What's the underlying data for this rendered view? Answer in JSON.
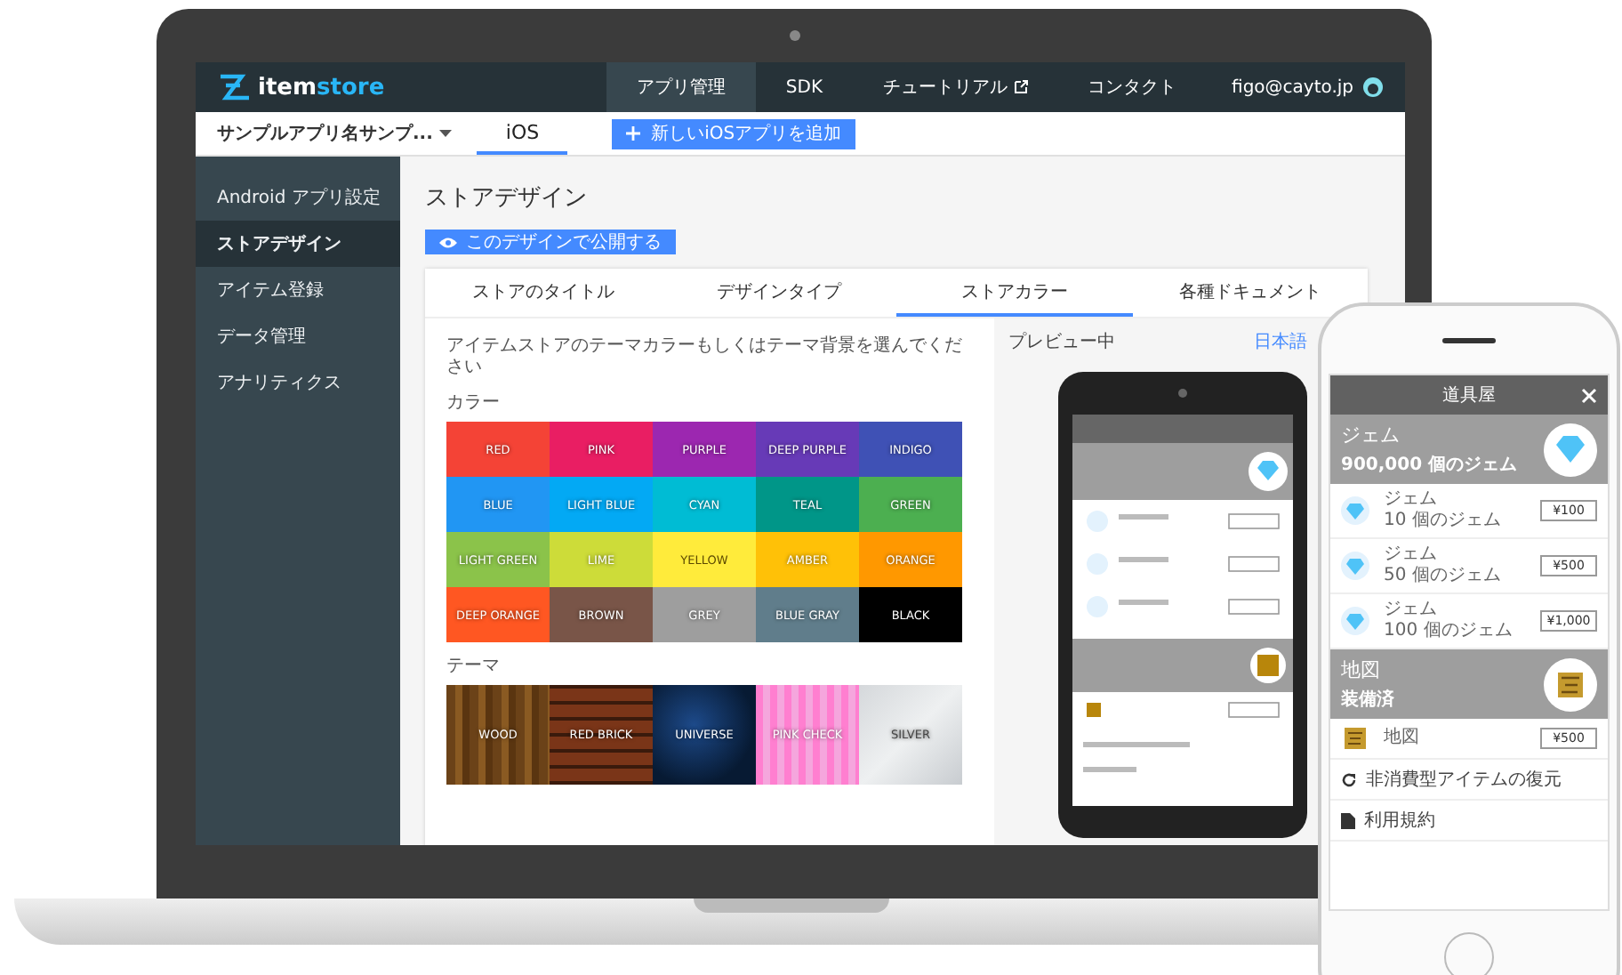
{
  "header": {
    "logo": {
      "part1": "item",
      "part2": "store"
    },
    "nav": [
      {
        "label": "アプリ管理",
        "selected": true,
        "external": false
      },
      {
        "label": "SDK",
        "selected": false,
        "external": false
      },
      {
        "label": "チュートリアル",
        "selected": false,
        "external": true
      },
      {
        "label": "コンタクト",
        "selected": false,
        "external": false
      }
    ],
    "account": "figo@cayto.jp"
  },
  "app_bar": {
    "app_select": "サンプルアプリ名サンプ...",
    "platform_tabs": [
      {
        "label": "iOS",
        "selected": true
      }
    ],
    "add_button": "新しいiOSアプリを追加"
  },
  "sidebar": {
    "items": [
      {
        "label": "Android アプリ設定",
        "selected": false
      },
      {
        "label": "ストアデザイン",
        "selected": true
      },
      {
        "label": "アイテム登録",
        "selected": false
      },
      {
        "label": "データ管理",
        "selected": false
      },
      {
        "label": "アナリティクス",
        "selected": false
      }
    ]
  },
  "page": {
    "title": "ストアデザイン",
    "publish_button": "このデザインで公開する",
    "tabs": [
      {
        "label": "ストアのタイトル",
        "selected": false
      },
      {
        "label": "デザインタイプ",
        "selected": false
      },
      {
        "label": "ストアカラー",
        "selected": true
      },
      {
        "label": "各種ドキュメント",
        "selected": false
      }
    ],
    "instruction": "アイテムストアのテーマカラーもしくはテーマ背景を選んでください",
    "color_label": "カラー",
    "colors": [
      {
        "label": "RED",
        "color": "#f44336"
      },
      {
        "label": "PINK",
        "color": "#e91e63"
      },
      {
        "label": "PURPLE",
        "color": "#9c27b0"
      },
      {
        "label": "DEEP PURPLE",
        "color": "#673ab7"
      },
      {
        "label": "INDIGO",
        "color": "#3f51b5"
      },
      {
        "label": "BLUE",
        "color": "#2196f3"
      },
      {
        "label": "LIGHT BLUE",
        "color": "#03a9f4"
      },
      {
        "label": "CYAN",
        "color": "#00bcd4"
      },
      {
        "label": "TEAL",
        "color": "#009688"
      },
      {
        "label": "GREEN",
        "color": "#4caf50"
      },
      {
        "label": "LIGHT GREEN",
        "color": "#8bc34a"
      },
      {
        "label": "LIME",
        "color": "#cddc39"
      },
      {
        "label": "YELLOW",
        "color": "#ffeb3b"
      },
      {
        "label": "AMBER",
        "color": "#ffc107"
      },
      {
        "label": "ORANGE",
        "color": "#ff9800"
      },
      {
        "label": "DEEP ORANGE",
        "color": "#ff5722"
      },
      {
        "label": "BROWN",
        "color": "#795548"
      },
      {
        "label": "GREY",
        "color": "#9e9e9e"
      },
      {
        "label": "BLUE GRAY",
        "color": "#607d8b"
      },
      {
        "label": "BLACK",
        "color": "#000000"
      }
    ],
    "theme_label": "テーマ",
    "themes": [
      {
        "label": "WOOD",
        "kind": "wood"
      },
      {
        "label": "RED BRICK",
        "kind": "brick"
      },
      {
        "label": "UNIVERSE",
        "kind": "universe"
      },
      {
        "label": "PINK CHECK",
        "kind": "check"
      },
      {
        "label": "SILVER",
        "kind": "silver"
      }
    ],
    "preview": {
      "label": "プレビュー中",
      "language": "日本語"
    }
  },
  "phone_store": {
    "title": "道具屋",
    "groups": [
      {
        "name": "ジェム",
        "balance": "900,000 個のジェム",
        "kind": "gem",
        "items": [
          {
            "name": "ジェム",
            "amount": "10 個のジェム",
            "price": "¥100"
          },
          {
            "name": "ジェム",
            "amount": "50 個のジェム",
            "price": "¥500"
          },
          {
            "name": "ジェム",
            "amount": "100 個のジェム",
            "price": "¥1,000"
          }
        ]
      },
      {
        "name": "地図",
        "balance": "装備済",
        "kind": "map",
        "items": [
          {
            "name": "地図",
            "price": "¥500"
          }
        ]
      }
    ],
    "links": [
      {
        "label": "非消費型アイテムの復元",
        "kind": "restore"
      },
      {
        "label": "利用規約",
        "kind": "document"
      }
    ]
  }
}
